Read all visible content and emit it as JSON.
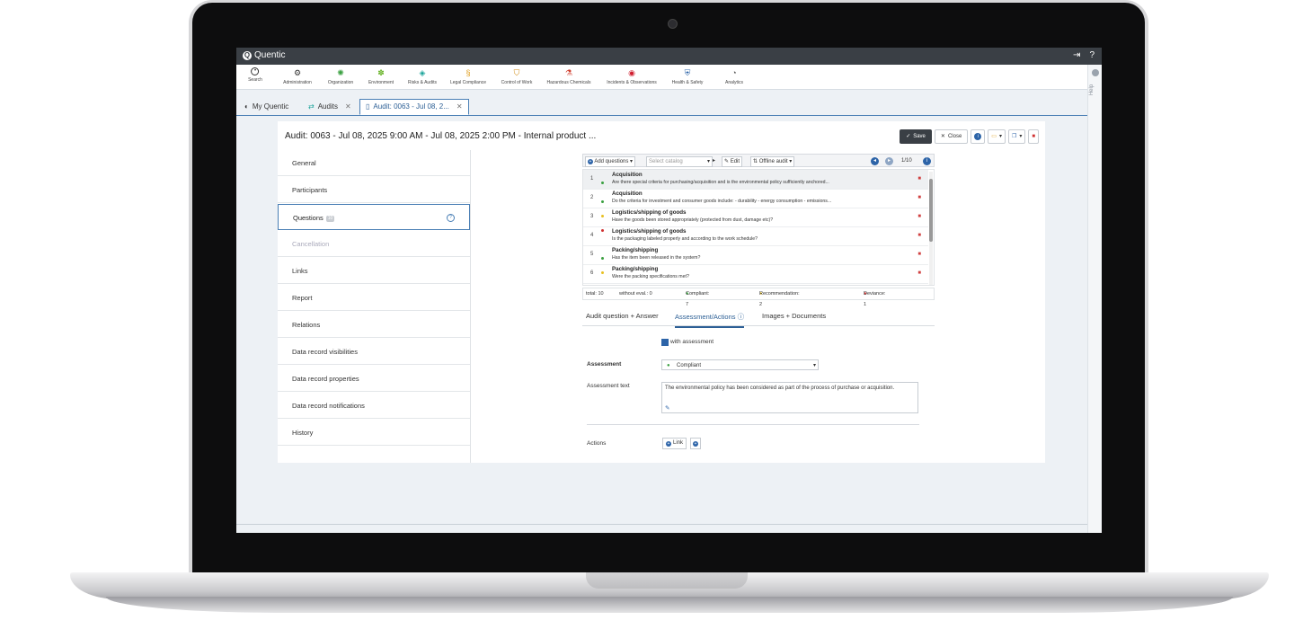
{
  "app": {
    "brand": "Quentic",
    "rail_label": "Help"
  },
  "modules": [
    {
      "label": "Search",
      "icon": "search-icon",
      "color": "#333333"
    },
    {
      "label": "Administration",
      "icon": "gear-icon",
      "color": "#333333"
    },
    {
      "label": "Organization",
      "icon": "organization-icon",
      "color": "#3aa040"
    },
    {
      "label": "Environment",
      "icon": "leaf-icon",
      "color": "#6bb52c"
    },
    {
      "label": "Risks & Audits",
      "icon": "risk-icon",
      "color": "#1aa39a"
    },
    {
      "label": "Legal Compliance",
      "icon": "paragraph-icon",
      "color": "#e0a020"
    },
    {
      "label": "Control of Work",
      "icon": "shield-icon",
      "color": "#d08a10"
    },
    {
      "label": "Hazardous Chemicals",
      "icon": "flask-icon",
      "color": "#d04030"
    },
    {
      "label": "Incidents & Observations",
      "icon": "incident-icon",
      "color": "#d02030"
    },
    {
      "label": "Health & Safety",
      "icon": "health-icon",
      "color": "#2d64a8"
    },
    {
      "label": "Analytics",
      "icon": "analytics-icon",
      "color": "#555555"
    }
  ],
  "tabs": [
    {
      "label": "My Quentic"
    },
    {
      "label": "Audits"
    },
    {
      "label": "Audit: 0063 - Jul 08, 2..."
    }
  ],
  "page": {
    "title": "Audit: 0063 - Jul 08, 2025 9:00 AM - Jul 08, 2025 2:00 PM - Internal product ...",
    "save": "Save",
    "close": "Close"
  },
  "nav": [
    {
      "label": "General"
    },
    {
      "label": "Participants"
    },
    {
      "label": "Questions",
      "badge": "10"
    },
    {
      "label": "Cancellation"
    },
    {
      "label": "Links"
    },
    {
      "label": "Report"
    },
    {
      "label": "Relations"
    },
    {
      "label": "Data record visibilities"
    },
    {
      "label": "Data record properties"
    },
    {
      "label": "Data record notifications"
    },
    {
      "label": "History"
    }
  ],
  "toolbar": {
    "add_questions": "Add questions",
    "catalog_placeholder": "Select catalog",
    "edit": "Edit",
    "offline_audit": "Offline audit",
    "counter": "1/10"
  },
  "questions": [
    {
      "n": "1",
      "title": "Acquisition",
      "text": "Are there special criteria for purchasing/acquisition and is the environmental policy sufficiently anchored...",
      "status": "green"
    },
    {
      "n": "2",
      "title": "Acquisition",
      "text": "Do the criteria for investment and consumer goods include: - durability - energy consumption - emissions...",
      "status": "green"
    },
    {
      "n": "3",
      "title": "Logistics/shipping of goods",
      "text": "Have the goods been stored appropriately (protected from dust, damage etc)?",
      "status": "yellow"
    },
    {
      "n": "4",
      "title": "Logistics/shipping of goods",
      "text": "Is the packaging labeled properly and according to the work schedule?",
      "status": "red"
    },
    {
      "n": "5",
      "title": "Packing/shipping",
      "text": "Has the item been released in the system?",
      "status": "green"
    },
    {
      "n": "6",
      "title": "Packing/shipping",
      "text": "Were the packing specifications met?",
      "status": "yellow"
    }
  ],
  "summary": {
    "total": "total: 10",
    "without": "without eval.: 0",
    "compliant": "Compliant: 7",
    "recommendation": "Recommendation: 2",
    "deviance": "Deviance: 1"
  },
  "subtabs": [
    {
      "label": "Audit question + Answer"
    },
    {
      "label": "Assessment/Actions"
    },
    {
      "label": "Images + Documents"
    }
  ],
  "form": {
    "with_assessment": "with assessment",
    "assessment_label": "Assessment",
    "assessment_value": "Compliant",
    "assessment_text_label": "Assessment text",
    "assessment_text": "The environmental policy has been considered as part of the process of purchase or acquisition.",
    "actions_label": "Actions",
    "link": "Link"
  },
  "colors": {
    "accent": "#2d64a8",
    "green": "#3aa040",
    "yellow": "#e8c020",
    "red": "#d03030"
  }
}
